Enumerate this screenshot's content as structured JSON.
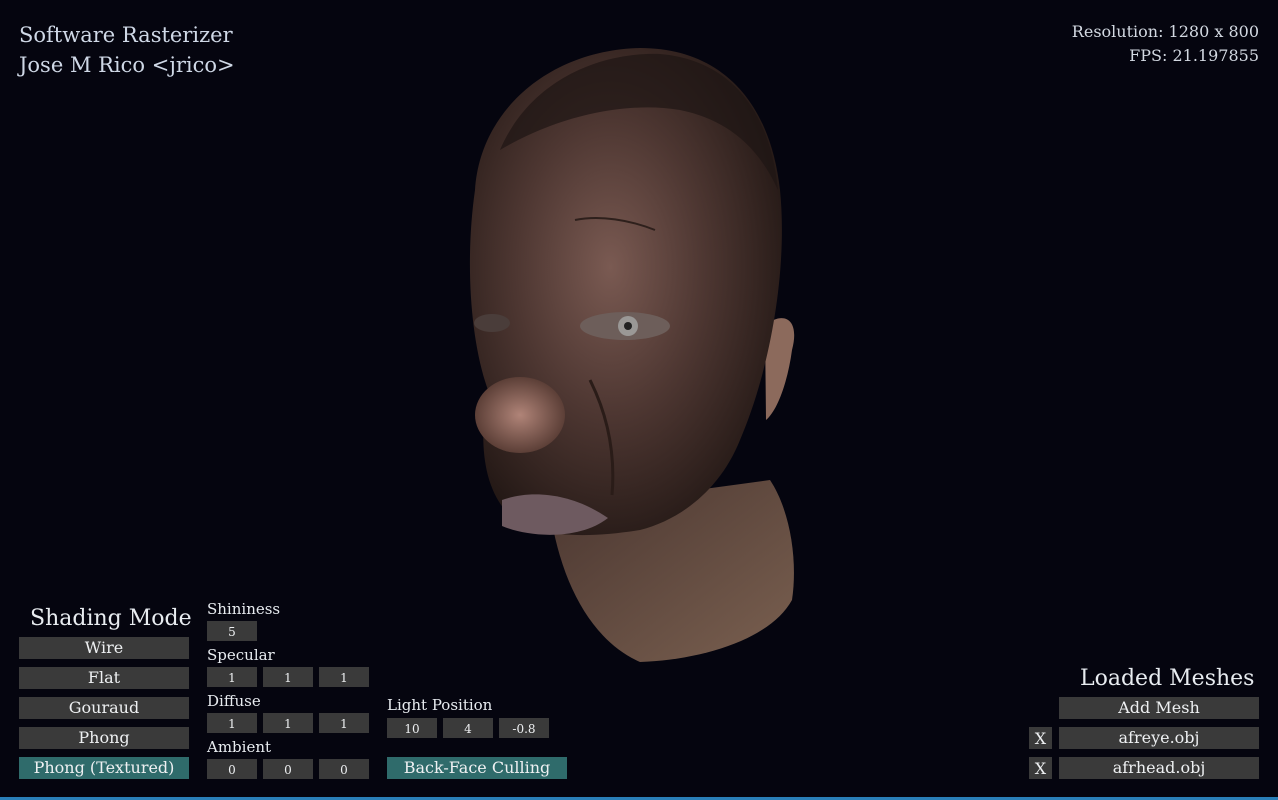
{
  "header": {
    "app_title": "Software Rasterizer",
    "author": "Jose M Rico <jrico>"
  },
  "stats": {
    "resolution": "Resolution: 1280 x 800",
    "fps": "FPS: 21.197855"
  },
  "shading": {
    "title": "Shading Mode",
    "modes": [
      "Wire",
      "Flat",
      "Gouraud",
      "Phong",
      "Phong (Textured)"
    ],
    "active": "Phong (Textured)"
  },
  "material": {
    "shininess_label": "Shininess",
    "shininess": "5",
    "specular_label": "Specular",
    "specular": [
      "1",
      "1",
      "1"
    ],
    "diffuse_label": "Diffuse",
    "diffuse": [
      "1",
      "1",
      "1"
    ],
    "ambient_label": "Ambient",
    "ambient": [
      "0",
      "0",
      "0"
    ]
  },
  "light": {
    "label": "Light Position",
    "position": [
      "10",
      "4",
      "-0.8"
    ],
    "backface_label": "Back-Face Culling"
  },
  "meshes": {
    "title": "Loaded Meshes",
    "add_label": "Add Mesh",
    "remove_label": "X",
    "items": [
      "afreye.obj",
      "afrhead.obj"
    ]
  },
  "colors": {
    "background": "#05050f",
    "button": "#3a3a3a",
    "button_active": "#2f6b6b",
    "taskbar_accent": "#2a7fb8"
  }
}
